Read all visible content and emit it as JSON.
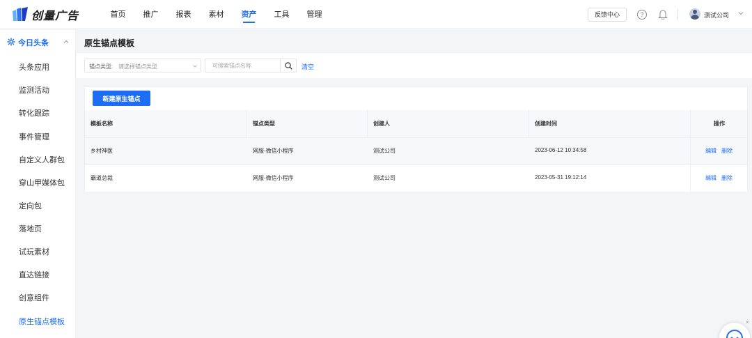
{
  "header": {
    "brand": "创量广告",
    "nav": [
      "首页",
      "推广",
      "报表",
      "素材",
      "资产",
      "工具",
      "管理"
    ],
    "active_nav": "资产",
    "feedback_label": "反馈中心",
    "help_glyph": "?",
    "username": "测试公司",
    "icons": [
      "logo-icon",
      "help-icon",
      "bell-icon",
      "avatar",
      "chevron-down-icon"
    ]
  },
  "sidebar": {
    "group_label": "今日头条",
    "items": [
      "头条应用",
      "监测活动",
      "转化跟踪",
      "事件管理",
      "自定义人群包",
      "穿山甲媒体包",
      "定向包",
      "落地页",
      "试玩素材",
      "直达链接",
      "创意组件",
      "原生锚点模板"
    ],
    "active_item": "原生锚点模板"
  },
  "main": {
    "title": "原生锚点模板",
    "filters": {
      "type_label": "锚点类型:",
      "type_placeholder": "请选择锚点类型",
      "search_placeholder": "可搜索锚点名称",
      "search_value": "",
      "clear_label": "清空"
    },
    "new_button_label": "新建原生锚点",
    "table": {
      "columns": [
        "模板名称",
        "锚点类型",
        "创建人",
        "创建时间",
        "操作"
      ],
      "rows": [
        {
          "name": "乡村神医",
          "type": "网服-微信小程序",
          "creator": "测试公司",
          "created": "2023-06-12 10:34:58",
          "edit": "编辑",
          "delete": "删除"
        },
        {
          "name": "霸道总裁",
          "type": "网服-微信小程序",
          "creator": "测试公司",
          "created": "2023-05-31 19:12:14",
          "edit": "编辑",
          "delete": "删除"
        }
      ]
    }
  },
  "float_close": "×",
  "colors": {
    "accent": "#1e6ef5",
    "page_bg": "#f4f5f7",
    "row_alt": "#f7f8fa"
  }
}
